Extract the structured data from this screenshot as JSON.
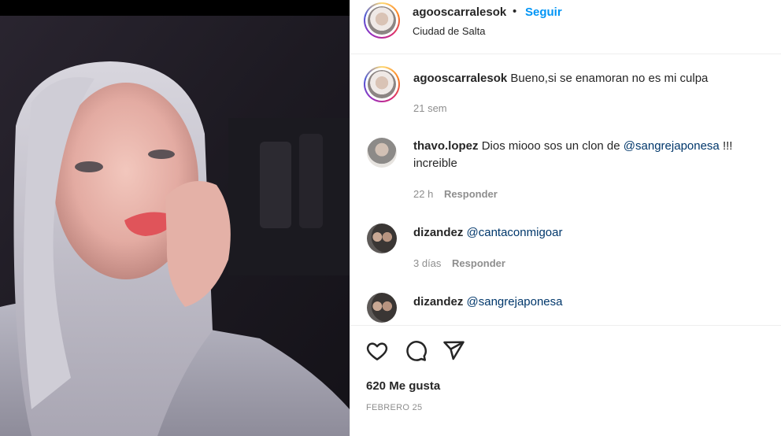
{
  "post": {
    "photo_alt": "post-photo",
    "header": {
      "username": "agooscarralesok",
      "separator": "•",
      "follow_label": "Seguir",
      "location": "Ciudad de Salta"
    },
    "caption": {
      "username": "agooscarralesok",
      "text": "Bueno,si se enamoran no es mi culpa",
      "time": "21 sem"
    },
    "comments": [
      {
        "username": "thavo.lopez",
        "text_before": "Dios miooo sos un clon de",
        "mention": "@sangrejaponesa",
        "text_after": "!!!",
        "line2": "increible",
        "time": "22 h",
        "reply_label": "Responder"
      },
      {
        "username": "dizandez",
        "mention": "@cantaconmigoar",
        "time": "3 días",
        "reply_label": "Responder"
      },
      {
        "username": "dizandez",
        "mention": "@sangrejaponesa"
      }
    ],
    "actions": {
      "like_icon": "heart-icon",
      "comment_icon": "comment-icon",
      "share_icon": "share-icon"
    },
    "likes": "620 Me gusta",
    "date": "FEBRERO 25"
  }
}
